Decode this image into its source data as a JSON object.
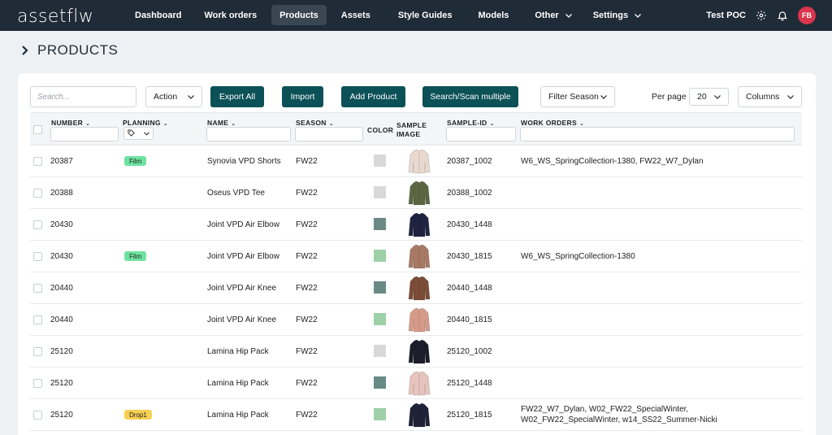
{
  "app": {
    "logo": "assetflw",
    "nav": [
      {
        "label": "Dashboard",
        "active": false,
        "dropdown": false
      },
      {
        "label": "Work orders",
        "active": false,
        "dropdown": false
      },
      {
        "label": "Products",
        "active": true,
        "dropdown": false
      },
      {
        "label": "Assets",
        "active": false,
        "dropdown": false
      },
      {
        "label": "Style Guides",
        "active": false,
        "dropdown": false
      },
      {
        "label": "Models",
        "active": false,
        "dropdown": false
      },
      {
        "label": "Other",
        "active": false,
        "dropdown": true
      },
      {
        "label": "Settings",
        "active": false,
        "dropdown": true
      }
    ],
    "account": "Test POC",
    "avatar_initials": "FB",
    "colors": {
      "nav_bg": "#1f2b37",
      "primary": "#0c5157",
      "avatar": "#d9354d"
    }
  },
  "page": {
    "title": "PRODUCTS"
  },
  "toolbar": {
    "search_placeholder": "Search...",
    "action_label": "Action",
    "export_all": "Export All",
    "import": "Import",
    "add_product": "Add Product",
    "search_scan": "Search/Scan multiple",
    "filter_season": "Filter Season",
    "per_page_label": "Per page",
    "per_page_value": "20",
    "columns_label": "Columns"
  },
  "table": {
    "headers": {
      "number": "NUMBER",
      "planning": "PLANNING",
      "name": "NAME",
      "season": "SEASON",
      "color": "COLOR",
      "sample_image_1": "SAMPLE",
      "sample_image_2": "IMAGE",
      "sample_id": "SAMPLE-ID",
      "work_orders": "WORK ORDERS"
    },
    "rows": [
      {
        "number": "20387",
        "planning": "Film",
        "planning_color": "#6ee3a0",
        "name": "Synovia VPD Shorts",
        "season": "FW22",
        "color": "#d8d8d8",
        "garment": "#ead9cf",
        "sample_id": "20387_1002",
        "work_orders": "W6_WS_SpringCollection-1380, FW22_W7_Dylan"
      },
      {
        "number": "20388",
        "planning": "",
        "planning_color": "",
        "name": "Oseus VPD Tee",
        "season": "FW22",
        "color": "#d8d8d8",
        "garment": "#5b6641",
        "sample_id": "20388_1002",
        "work_orders": ""
      },
      {
        "number": "20430",
        "planning": "",
        "planning_color": "",
        "name": "Joint VPD Air Elbow",
        "season": "FW22",
        "color": "#6a8a86",
        "garment": "#1f2340",
        "sample_id": "20430_1448",
        "work_orders": ""
      },
      {
        "number": "20430",
        "planning": "Film",
        "planning_color": "#6ee3a0",
        "name": "Joint VPD Air Elbow",
        "season": "FW22",
        "color": "#9dd0a6",
        "garment": "#a87964",
        "sample_id": "20430_1815",
        "work_orders": "W6_WS_SpringCollection-1380"
      },
      {
        "number": "20440",
        "planning": "",
        "planning_color": "",
        "name": "Joint VPD Air Knee",
        "season": "FW22",
        "color": "#6a8a86",
        "garment": "#7b4c37",
        "sample_id": "20440_1448",
        "work_orders": ""
      },
      {
        "number": "20440",
        "planning": "",
        "planning_color": "",
        "name": "Joint VPD Air Knee",
        "season": "FW22",
        "color": "#9dd0a6",
        "garment": "#d69b88",
        "sample_id": "20440_1815",
        "work_orders": ""
      },
      {
        "number": "25120",
        "planning": "",
        "planning_color": "",
        "name": "Lamina Hip Pack",
        "season": "FW22",
        "color": "#d8d8d8",
        "garment": "#1c1d2b",
        "sample_id": "25120_1002",
        "work_orders": ""
      },
      {
        "number": "25120",
        "planning": "",
        "planning_color": "",
        "name": "Lamina Hip Pack",
        "season": "FW22",
        "color": "#6a8a86",
        "garment": "#e7c4bd",
        "sample_id": "25120_1448",
        "work_orders": ""
      },
      {
        "number": "25120",
        "planning": "Drop1",
        "planning_color": "#f7d154",
        "name": "Lamina Hip Pack",
        "season": "FW22",
        "color": "#9dd0a6",
        "garment": "#1f2238",
        "sample_id": "25120_1815",
        "work_orders": "FW22_W7_Dylan, W02_FW22_SpecialWinter, W02_FW22_SpecialWinter, w14_SS22_Summer-Nicki"
      }
    ]
  }
}
